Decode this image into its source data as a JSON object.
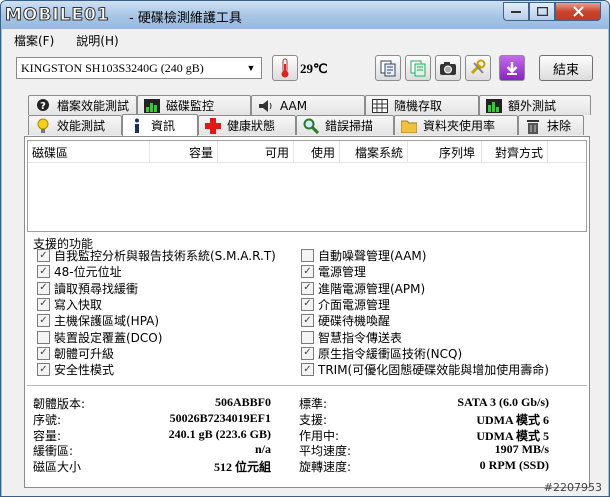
{
  "window": {
    "logo_text": "MOBILE01",
    "title": "- 硬碟檢測維護工具"
  },
  "menu": [
    "檔案(F)",
    "說明(H)"
  ],
  "toolbar": {
    "drive": "KINGSTON SH103S3240G (240 gB)",
    "temperature": "29℃",
    "exit_label": "結束"
  },
  "tabs_row1": [
    {
      "label": "檔案效能測試",
      "icon": "report-icon"
    },
    {
      "label": "磁碟監控",
      "icon": "chart-icon"
    },
    {
      "label": "AAM",
      "icon": "speaker-icon"
    },
    {
      "label": "隨機存取",
      "icon": "grid-icon"
    },
    {
      "label": "額外測試",
      "icon": "chart-icon"
    }
  ],
  "tabs_row2": [
    {
      "label": "效能測試",
      "icon": "bulb-icon"
    },
    {
      "label": "資訊",
      "icon": "info-icon",
      "active": true
    },
    {
      "label": "健康狀態",
      "icon": "plus-icon"
    },
    {
      "label": "錯誤掃描",
      "icon": "magnifier-icon"
    },
    {
      "label": "資料夾使用率",
      "icon": "folder-icon"
    },
    {
      "label": "抹除",
      "icon": "trash-icon"
    }
  ],
  "table": {
    "headers": [
      "磁碟區",
      "容量",
      "可用",
      "使用",
      "檔案系統",
      "序列埠",
      "對齊方式"
    ]
  },
  "features": {
    "title": "支援的功能",
    "left": [
      {
        "label": "自我監控分析與報告技術系統(S.M.A.R.T)",
        "checked": true
      },
      {
        "label": "48-位元位址",
        "checked": true
      },
      {
        "label": "讀取預尋找緩衝",
        "checked": true
      },
      {
        "label": "寫入快取",
        "checked": true
      },
      {
        "label": "主機保護區域(HPA)",
        "checked": true
      },
      {
        "label": "裝置設定覆蓋(DCO)",
        "checked": false
      },
      {
        "label": "韌體可升級",
        "checked": true
      },
      {
        "label": "安全性模式",
        "checked": true
      }
    ],
    "right": [
      {
        "label": "自動噪聲管理(AAM)",
        "checked": false
      },
      {
        "label": "電源管理",
        "checked": true
      },
      {
        "label": "進階電源管理(APM)",
        "checked": true
      },
      {
        "label": "介面電源管理",
        "checked": true
      },
      {
        "label": "硬碟待機喚醒",
        "checked": true
      },
      {
        "label": "智慧指令傳送表",
        "checked": false
      },
      {
        "label": "原生指令緩衝區技術(NCQ)",
        "checked": true
      },
      {
        "label": "TRIM(可優化固態硬碟效能與增加使用壽命)",
        "checked": true
      }
    ]
  },
  "info": {
    "left": [
      {
        "label": "韌體版本:",
        "value": "506ABBF0"
      },
      {
        "label": "序號:",
        "value": "50026B7234019EF1"
      },
      {
        "label": "容量:",
        "value": "240.1 gB (223.6 GB)"
      },
      {
        "label": "緩衝區:",
        "value": "n/a"
      },
      {
        "label": "磁區大小",
        "value": "512 位元組"
      }
    ],
    "right": [
      {
        "label": "標準:",
        "value": "SATA 3 (6.0 Gb/s)"
      },
      {
        "label": "支援:",
        "value": "UDMA 模式 6"
      },
      {
        "label": "作用中:",
        "value": "UDMA 模式 5"
      },
      {
        "label": "平均速度:",
        "value": "1907 MB/s"
      },
      {
        "label": "旋轉速度:",
        "value": "0 RPM (SSD)"
      }
    ]
  },
  "watermark": "#2207953",
  "colors": {
    "title_bar": "#a9c6e6",
    "close_button": "#c9462f",
    "purple_button": "#9b2fc8"
  }
}
